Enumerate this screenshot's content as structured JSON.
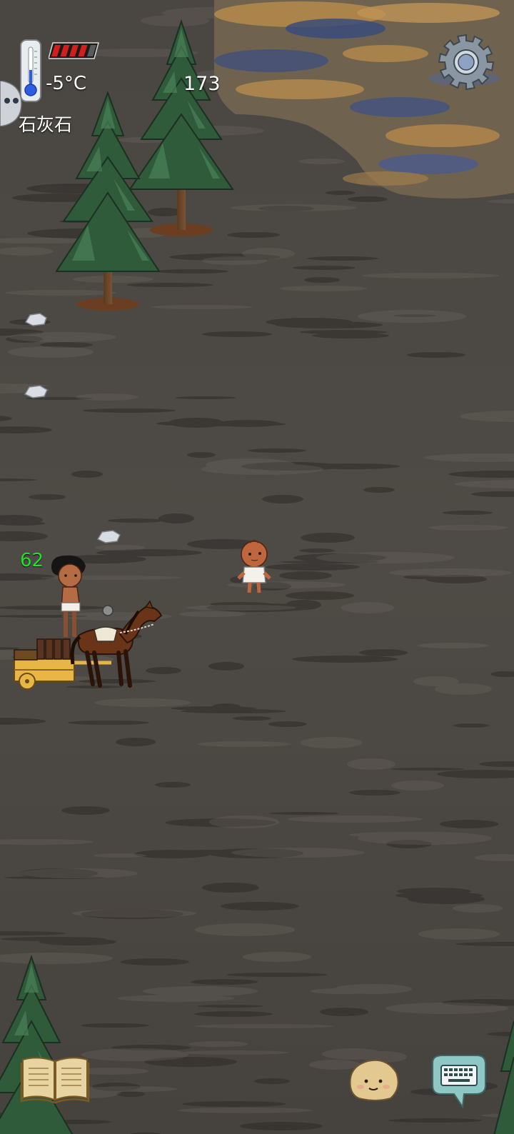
{
  "hud": {
    "temperature": "-5°C",
    "counter": "173",
    "held_item": "石灰石",
    "food_pips_filled": 4,
    "food_pips_total": 5
  },
  "world": {
    "other_player_age": "62"
  },
  "icons": {
    "thermometer": "thermometer-icon",
    "settings": "gear-icon",
    "recipe_book": "book-icon",
    "emote": "face-icon",
    "chat": "keyboard-icon"
  },
  "colors": {
    "ground": "#4b4743",
    "age_label": "#22e02a",
    "food_pip_filled": "#d41e1e",
    "food_pip_empty": "#5a5a5a",
    "pine": "#2f5b3a",
    "chat_bubble": "#8fc7c4"
  }
}
